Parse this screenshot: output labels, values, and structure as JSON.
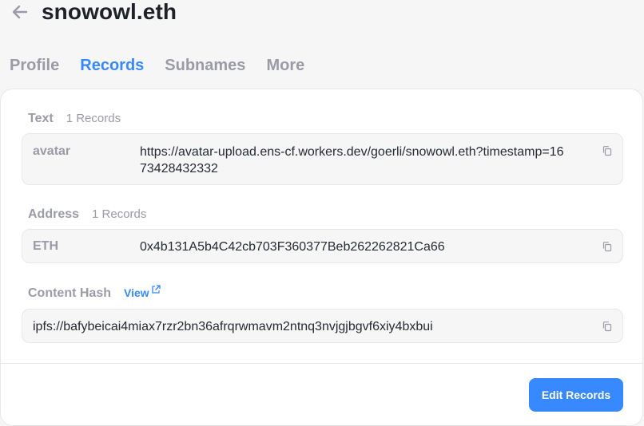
{
  "header": {
    "back_icon": "arrow-left-icon",
    "title": "snowowl.eth"
  },
  "tabs": [
    {
      "label": "Profile",
      "active": false
    },
    {
      "label": "Records",
      "active": true
    },
    {
      "label": "Subnames",
      "active": false
    },
    {
      "label": "More",
      "active": false
    }
  ],
  "text_section": {
    "title": "Text",
    "count": "1 Records",
    "records": [
      {
        "key": "avatar",
        "value_line1": "https://avatar-upload.ens-cf.workers.dev/goerli/snowowl.eth?timestamp=16",
        "value_line2": "73428432332"
      }
    ]
  },
  "address_section": {
    "title": "Address",
    "count": "1 Records",
    "records": [
      {
        "key": "ETH",
        "value": "0x4b131A5b4C42cb703F360377Beb262262821Ca66"
      }
    ]
  },
  "content_hash_section": {
    "title": "Content Hash",
    "view_label": "View",
    "value": "ipfs://bafybeicai4miax7rzr2bn36afrqrwmavm2ntnq3nvjgjbgvf6xiy4bxbui"
  },
  "actions": {
    "edit_label": "Edit Records"
  },
  "colors": {
    "accent": "#3889ff",
    "muted": "#9b9ba7",
    "text": "#262a33"
  },
  "icons": {
    "copy": "copy-icon",
    "external_link": "external-link-icon"
  }
}
